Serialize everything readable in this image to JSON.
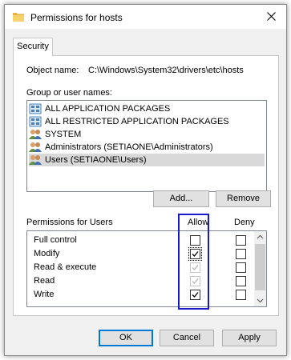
{
  "window": {
    "title": "Permissions for hosts"
  },
  "tabs": [
    {
      "label": "Security"
    }
  ],
  "object": {
    "label": "Object name:",
    "value": "C:\\Windows\\System32\\drivers\\etc\\hosts"
  },
  "groups": {
    "label": "Group or user names:",
    "items": [
      {
        "label": "ALL APPLICATION PACKAGES",
        "icon": "package-group-icon"
      },
      {
        "label": "ALL RESTRICTED APPLICATION PACKAGES",
        "icon": "package-group-icon"
      },
      {
        "label": "SYSTEM",
        "icon": "users-group-icon"
      },
      {
        "label": "Administrators (SETIAONE\\Administrators)",
        "icon": "users-group-icon"
      },
      {
        "label": "Users (SETIAONE\\Users)",
        "icon": "users-group-icon",
        "selected": true
      }
    ],
    "add_label": "Add...",
    "remove_label": "Remove"
  },
  "permissions": {
    "header": "Permissions for Users",
    "allow_label": "Allow",
    "deny_label": "Deny",
    "rows": [
      {
        "name": "Full control",
        "allow": "unchecked",
        "deny": "unchecked"
      },
      {
        "name": "Modify",
        "allow": "checked-focused",
        "deny": "unchecked"
      },
      {
        "name": "Read & execute",
        "allow": "checked-disabled",
        "deny": "unchecked"
      },
      {
        "name": "Read",
        "allow": "checked-disabled",
        "deny": "unchecked"
      },
      {
        "name": "Write",
        "allow": "checked",
        "deny": "unchecked"
      }
    ]
  },
  "footer": {
    "ok_label": "OK",
    "cancel_label": "Cancel",
    "apply_label": "Apply"
  },
  "colors": {
    "selection": "#d9d9d9",
    "highlight_box": "#1a1acc",
    "default_button": "#0078d7"
  }
}
